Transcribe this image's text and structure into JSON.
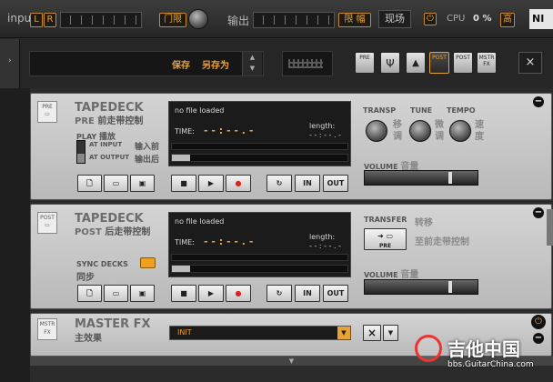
{
  "top": {
    "input_icon": "input",
    "lr": [
      "L",
      "R"
    ],
    "limit_label": "门限",
    "output_label": "输出",
    "limiter_btn": "限 幅",
    "live_btn": "现场",
    "cpu_label": "CPU",
    "cpu_value": "0 %",
    "hi_btn": "高",
    "logo": "NI"
  },
  "toolbar": {
    "save": "保存",
    "save_as": "另存为",
    "pre_btn": "PRE",
    "post_btn": "POST",
    "mstr_btn": "MSTR",
    "fx_btn": "FX",
    "close": "×"
  },
  "pre": {
    "badge": "PRE",
    "title": "TAPEDECK",
    "sub": "PRE",
    "sub_cn": "前走带控制",
    "play": "PLAY",
    "play_cn": "播放",
    "at_input": "AT INPUT",
    "at_input_cn": "输入前",
    "at_output": "AT OUTPUT",
    "at_output_cn": "输出后",
    "file": "no file loaded",
    "time_label": "TIME:",
    "time": "- - : - - . -",
    "length_label": "length:",
    "length": "- - : - - . -",
    "transp": "TRANSP",
    "tune": "TUNE",
    "tempo": "TEMPO",
    "transp_cn": "移调",
    "tune_cn": "微调",
    "tempo_cn": "速度",
    "volume": "VOLUME",
    "volume_cn": "音量",
    "in": "IN",
    "out": "OUT"
  },
  "post": {
    "badge": "POST",
    "title": "TAPEDECK",
    "sub": "POST",
    "sub_cn": "后走带控制",
    "sync": "SYNC DECKS",
    "sync_cn": "同步",
    "file": "no file loaded",
    "time_label": "TIME:",
    "time": "- - : - - . -",
    "length_label": "length:",
    "length": "- - : - - . -",
    "transfer": "TRANSFER",
    "transfer_cn": "转移",
    "transfer_target": "至前走带控制",
    "transfer_icon_label": "PRE",
    "volume": "VOLUME",
    "volume_cn": "音量",
    "in": "IN",
    "out": "OUT"
  },
  "master": {
    "badge1": "MSTR",
    "badge2": "FX",
    "title": "MASTER FX",
    "title_cn": "主效果",
    "preset": "INIT",
    "close": "×"
  },
  "watermark": {
    "text": "吉他中国",
    "url": "bbs.GuitarChina.com"
  }
}
